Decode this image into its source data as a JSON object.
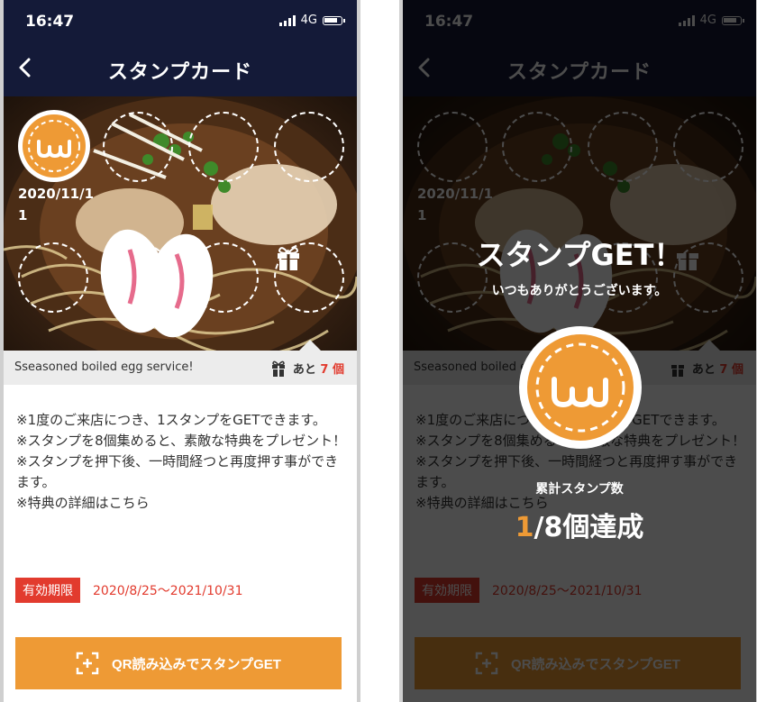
{
  "status_bar": {
    "time": "16:47",
    "network": "4G"
  },
  "nav": {
    "title": "スタンプカード"
  },
  "card": {
    "stamp_date": "2020/11/11",
    "total_slots": 8,
    "stamped": 1,
    "reward_text": "Sseasoned boiled egg service!",
    "remaining_prefix": "あと",
    "remaining_count": "7",
    "remaining_unit": "個"
  },
  "description": [
    "※1度のご来店につき、1スタンプをGETできます。",
    "※スタンプを8個集めると、素敵な特典をプレゼント！",
    "※スタンプを押下後、一時間経つと再度押す事ができます。",
    "※特典の詳細はこちら"
  ],
  "validity": {
    "label": "有効期限",
    "period": "2020/8/25〜2021/10/31"
  },
  "qr_button": {
    "label": "QR読み込みでスタンプGET"
  },
  "modal": {
    "title": "スタンプGET！",
    "subtitle": "いつもありがとうございます。",
    "count_label": "累計スタンプ数",
    "current": "1",
    "separator": "/",
    "total": "8",
    "suffix": "個達成"
  },
  "colors": {
    "header": "#141a38",
    "accent": "#ee9a35",
    "alert": "#e23b2e"
  }
}
